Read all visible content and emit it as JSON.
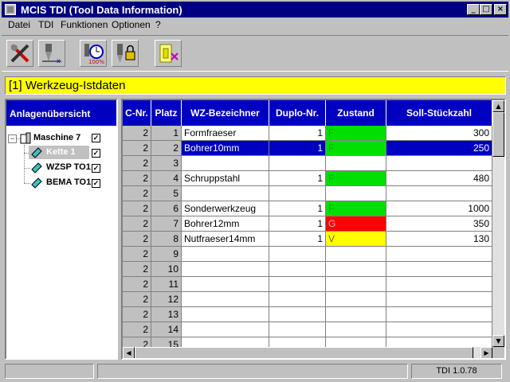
{
  "window": {
    "title": "MCIS TDI (Tool Data Information)"
  },
  "menu": [
    "Datei",
    "TDI",
    "Funktionen",
    "Optionen",
    "?"
  ],
  "toolbar": [
    "tools-icon",
    "drill-move-icon",
    "clock-100-icon",
    "drill-lock-icon",
    "exit-icon"
  ],
  "header": {
    "title": "[1] Werkzeug-Istdaten"
  },
  "tree": {
    "heading": "Anlagenübersicht",
    "nodes": [
      {
        "label": "Maschine 7",
        "checked": true
      },
      {
        "label": "Kette 1",
        "checked": true
      },
      {
        "label": "WZSP TO1",
        "checked": true
      },
      {
        "label": "BEMA TO1",
        "checked": true
      }
    ]
  },
  "grid": {
    "columns": [
      "C-Nr.",
      "Platz",
      "WZ-Bezeichner",
      "Duplo-Nr.",
      "Zustand",
      "Soll-Stückzahl"
    ],
    "rows": [
      {
        "c": "2",
        "platz": "1",
        "name": "Formfraeser",
        "duplo": "1",
        "zustand": "F",
        "soll": "300"
      },
      {
        "c": "2",
        "platz": "2",
        "name": "Bohrer10mm",
        "duplo": "1",
        "zustand": "F",
        "soll": "250"
      },
      {
        "c": "2",
        "platz": "3",
        "name": "",
        "duplo": "",
        "zustand": "",
        "soll": ""
      },
      {
        "c": "2",
        "platz": "4",
        "name": "Schruppstahl",
        "duplo": "1",
        "zustand": "F",
        "soll": "480"
      },
      {
        "c": "2",
        "platz": "5",
        "name": "",
        "duplo": "",
        "zustand": "",
        "soll": ""
      },
      {
        "c": "2",
        "platz": "6",
        "name": "Sonderwerkzeug",
        "duplo": "1",
        "zustand": "F",
        "soll": "1000"
      },
      {
        "c": "2",
        "platz": "7",
        "name": "Bohrer12mm",
        "duplo": "1",
        "zustand": "G",
        "soll": "350"
      },
      {
        "c": "2",
        "platz": "8",
        "name": "Nutfraeser14mm",
        "duplo": "1",
        "zustand": "V",
        "soll": "130"
      },
      {
        "c": "2",
        "platz": "9",
        "name": "",
        "duplo": "",
        "zustand": "",
        "soll": ""
      },
      {
        "c": "2",
        "platz": "10",
        "name": "",
        "duplo": "",
        "zustand": "",
        "soll": ""
      },
      {
        "c": "2",
        "platz": "11",
        "name": "",
        "duplo": "",
        "zustand": "",
        "soll": ""
      },
      {
        "c": "2",
        "platz": "12",
        "name": "",
        "duplo": "",
        "zustand": "",
        "soll": ""
      },
      {
        "c": "2",
        "platz": "13",
        "name": "",
        "duplo": "",
        "zustand": "",
        "soll": ""
      },
      {
        "c": "2",
        "platz": "14",
        "name": "",
        "duplo": "",
        "zustand": "",
        "soll": ""
      },
      {
        "c": "2",
        "platz": "15",
        "name": "",
        "duplo": "",
        "zustand": "",
        "soll": ""
      }
    ],
    "selected_row": 1
  },
  "status_colors": {
    "F": "#00e000",
    "G": "#ff0000",
    "V": "#ffff00"
  },
  "statusbar": {
    "version": "TDI 1.0.78"
  }
}
